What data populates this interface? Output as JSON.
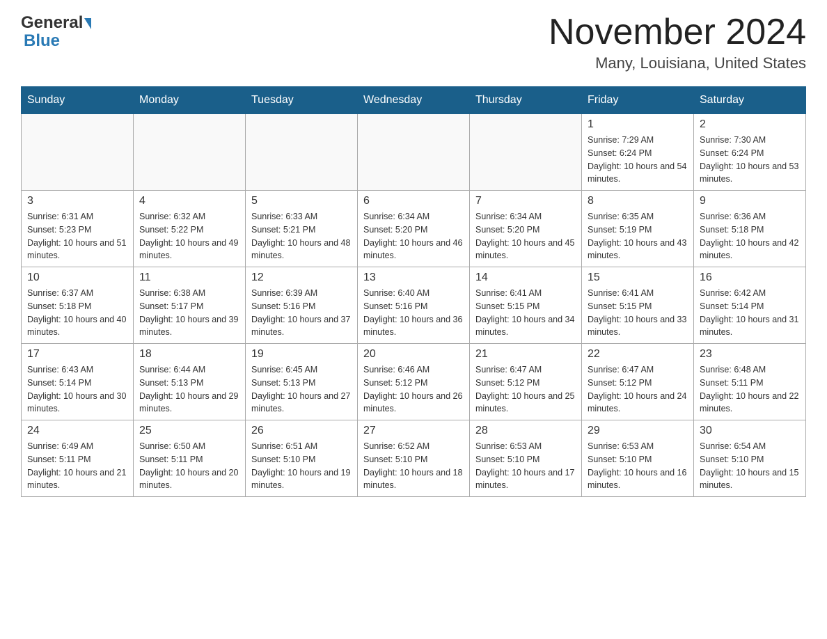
{
  "header": {
    "logo_general": "General",
    "logo_blue": "Blue",
    "month_title": "November 2024",
    "location": "Many, Louisiana, United States"
  },
  "days_of_week": [
    "Sunday",
    "Monday",
    "Tuesday",
    "Wednesday",
    "Thursday",
    "Friday",
    "Saturday"
  ],
  "weeks": [
    [
      {
        "day": "",
        "info": ""
      },
      {
        "day": "",
        "info": ""
      },
      {
        "day": "",
        "info": ""
      },
      {
        "day": "",
        "info": ""
      },
      {
        "day": "",
        "info": ""
      },
      {
        "day": "1",
        "info": "Sunrise: 7:29 AM\nSunset: 6:24 PM\nDaylight: 10 hours and 54 minutes."
      },
      {
        "day": "2",
        "info": "Sunrise: 7:30 AM\nSunset: 6:24 PM\nDaylight: 10 hours and 53 minutes."
      }
    ],
    [
      {
        "day": "3",
        "info": "Sunrise: 6:31 AM\nSunset: 5:23 PM\nDaylight: 10 hours and 51 minutes."
      },
      {
        "day": "4",
        "info": "Sunrise: 6:32 AM\nSunset: 5:22 PM\nDaylight: 10 hours and 49 minutes."
      },
      {
        "day": "5",
        "info": "Sunrise: 6:33 AM\nSunset: 5:21 PM\nDaylight: 10 hours and 48 minutes."
      },
      {
        "day": "6",
        "info": "Sunrise: 6:34 AM\nSunset: 5:20 PM\nDaylight: 10 hours and 46 minutes."
      },
      {
        "day": "7",
        "info": "Sunrise: 6:34 AM\nSunset: 5:20 PM\nDaylight: 10 hours and 45 minutes."
      },
      {
        "day": "8",
        "info": "Sunrise: 6:35 AM\nSunset: 5:19 PM\nDaylight: 10 hours and 43 minutes."
      },
      {
        "day": "9",
        "info": "Sunrise: 6:36 AM\nSunset: 5:18 PM\nDaylight: 10 hours and 42 minutes."
      }
    ],
    [
      {
        "day": "10",
        "info": "Sunrise: 6:37 AM\nSunset: 5:18 PM\nDaylight: 10 hours and 40 minutes."
      },
      {
        "day": "11",
        "info": "Sunrise: 6:38 AM\nSunset: 5:17 PM\nDaylight: 10 hours and 39 minutes."
      },
      {
        "day": "12",
        "info": "Sunrise: 6:39 AM\nSunset: 5:16 PM\nDaylight: 10 hours and 37 minutes."
      },
      {
        "day": "13",
        "info": "Sunrise: 6:40 AM\nSunset: 5:16 PM\nDaylight: 10 hours and 36 minutes."
      },
      {
        "day": "14",
        "info": "Sunrise: 6:41 AM\nSunset: 5:15 PM\nDaylight: 10 hours and 34 minutes."
      },
      {
        "day": "15",
        "info": "Sunrise: 6:41 AM\nSunset: 5:15 PM\nDaylight: 10 hours and 33 minutes."
      },
      {
        "day": "16",
        "info": "Sunrise: 6:42 AM\nSunset: 5:14 PM\nDaylight: 10 hours and 31 minutes."
      }
    ],
    [
      {
        "day": "17",
        "info": "Sunrise: 6:43 AM\nSunset: 5:14 PM\nDaylight: 10 hours and 30 minutes."
      },
      {
        "day": "18",
        "info": "Sunrise: 6:44 AM\nSunset: 5:13 PM\nDaylight: 10 hours and 29 minutes."
      },
      {
        "day": "19",
        "info": "Sunrise: 6:45 AM\nSunset: 5:13 PM\nDaylight: 10 hours and 27 minutes."
      },
      {
        "day": "20",
        "info": "Sunrise: 6:46 AM\nSunset: 5:12 PM\nDaylight: 10 hours and 26 minutes."
      },
      {
        "day": "21",
        "info": "Sunrise: 6:47 AM\nSunset: 5:12 PM\nDaylight: 10 hours and 25 minutes."
      },
      {
        "day": "22",
        "info": "Sunrise: 6:47 AM\nSunset: 5:12 PM\nDaylight: 10 hours and 24 minutes."
      },
      {
        "day": "23",
        "info": "Sunrise: 6:48 AM\nSunset: 5:11 PM\nDaylight: 10 hours and 22 minutes."
      }
    ],
    [
      {
        "day": "24",
        "info": "Sunrise: 6:49 AM\nSunset: 5:11 PM\nDaylight: 10 hours and 21 minutes."
      },
      {
        "day": "25",
        "info": "Sunrise: 6:50 AM\nSunset: 5:11 PM\nDaylight: 10 hours and 20 minutes."
      },
      {
        "day": "26",
        "info": "Sunrise: 6:51 AM\nSunset: 5:10 PM\nDaylight: 10 hours and 19 minutes."
      },
      {
        "day": "27",
        "info": "Sunrise: 6:52 AM\nSunset: 5:10 PM\nDaylight: 10 hours and 18 minutes."
      },
      {
        "day": "28",
        "info": "Sunrise: 6:53 AM\nSunset: 5:10 PM\nDaylight: 10 hours and 17 minutes."
      },
      {
        "day": "29",
        "info": "Sunrise: 6:53 AM\nSunset: 5:10 PM\nDaylight: 10 hours and 16 minutes."
      },
      {
        "day": "30",
        "info": "Sunrise: 6:54 AM\nSunset: 5:10 PM\nDaylight: 10 hours and 15 minutes."
      }
    ]
  ]
}
